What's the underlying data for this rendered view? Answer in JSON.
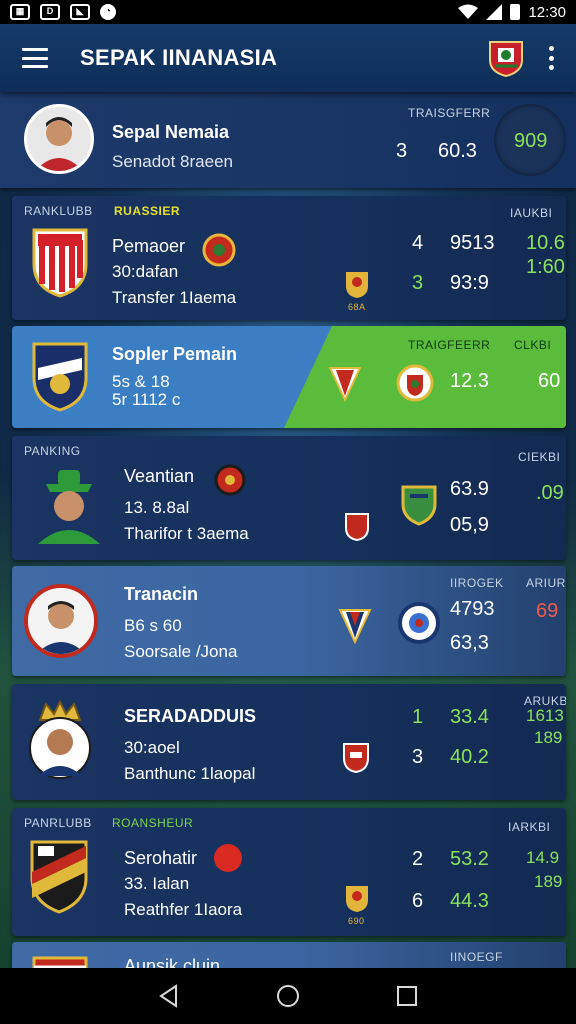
{
  "status_bar": {
    "time": "12:30",
    "icons": [
      "notification-icon",
      "app-icon",
      "clock-icon",
      "wifi-icon",
      "signal-icon",
      "battery-icon"
    ]
  },
  "app_bar": {
    "title": "SEPAK IINANASIA",
    "logo": "league-crest-icon"
  },
  "cards": [
    {
      "header_right": "TRAISGFERR",
      "name": "Sepal Nemaia",
      "sub1": "Senadot 8raeen",
      "rank": "3",
      "value": "60.3",
      "badge": "909"
    },
    {
      "header_left": "RANKLUBB",
      "header_mid": "RUASSIER",
      "header_right": "IAUKBI",
      "name": "Pemaoer",
      "sub1": "30:dafan",
      "sub2": "Transfer 1Iaema",
      "rows": [
        {
          "rank": "4",
          "value": "9513",
          "extra": "10.6"
        },
        {
          "rank": "3",
          "value": "93:9",
          "extra": "1:60"
        }
      ],
      "mini_label": "68A"
    },
    {
      "header_mid": "TRAIGFEERR",
      "header_right": "CLKBI",
      "name": "Sopler Pemain",
      "sub1": "5s & 18",
      "sub2": "5r 1112 c",
      "value": "12.3",
      "extra": "60"
    },
    {
      "header_left": "PANKING",
      "header_right": "CIEKBI",
      "name": "Veantian",
      "sub1": "13. 8.8al",
      "sub2": "Tharifor t 3aema",
      "value": "63.9",
      "value2": "05,9",
      "extra": ".09"
    },
    {
      "header_mid": "IIROGEK",
      "header_right": "ARIURI",
      "name": "Tranacin",
      "sub1": "B6 s 60",
      "sub2": "Soorsale /Jona",
      "value": "4793",
      "value2": "63,3",
      "extra": "69"
    },
    {
      "header_right": "ARUKBI",
      "name": "SERADADDUIS",
      "sub1": "30:aoel",
      "sub2": "Banthunc 1laopal",
      "rows": [
        {
          "rank": "1",
          "value": "33.4",
          "extra": "1613"
        },
        {
          "rank": "3",
          "value": "40.2",
          "extra": "189"
        }
      ]
    },
    {
      "header_left": "PANRLUBB",
      "header_mid": "ROANSHEUR",
      "header_right": "IARKBI",
      "name": "Serohatir",
      "sub1": "33. Ialan",
      "sub2": "Reathfer 1Iaora",
      "rows": [
        {
          "rank": "2",
          "value": "53.2",
          "extra": "14.9"
        },
        {
          "rank": "6",
          "value": "44.3",
          "extra": "189"
        }
      ],
      "mini_label": "690"
    },
    {
      "header_mid": "IINOEGF",
      "name": "Aunsik cluin"
    }
  ],
  "nav": {
    "back": "back-icon",
    "home": "home-icon",
    "recents": "recents-icon"
  },
  "colors": {
    "app_bar": "#153a6a",
    "highlight_blue": "#3b7ec4",
    "highlight_green": "#5abc3a",
    "value_green": "#8be15a",
    "value_red": "#ef5a4a",
    "header_yellow": "#e7e02f"
  }
}
